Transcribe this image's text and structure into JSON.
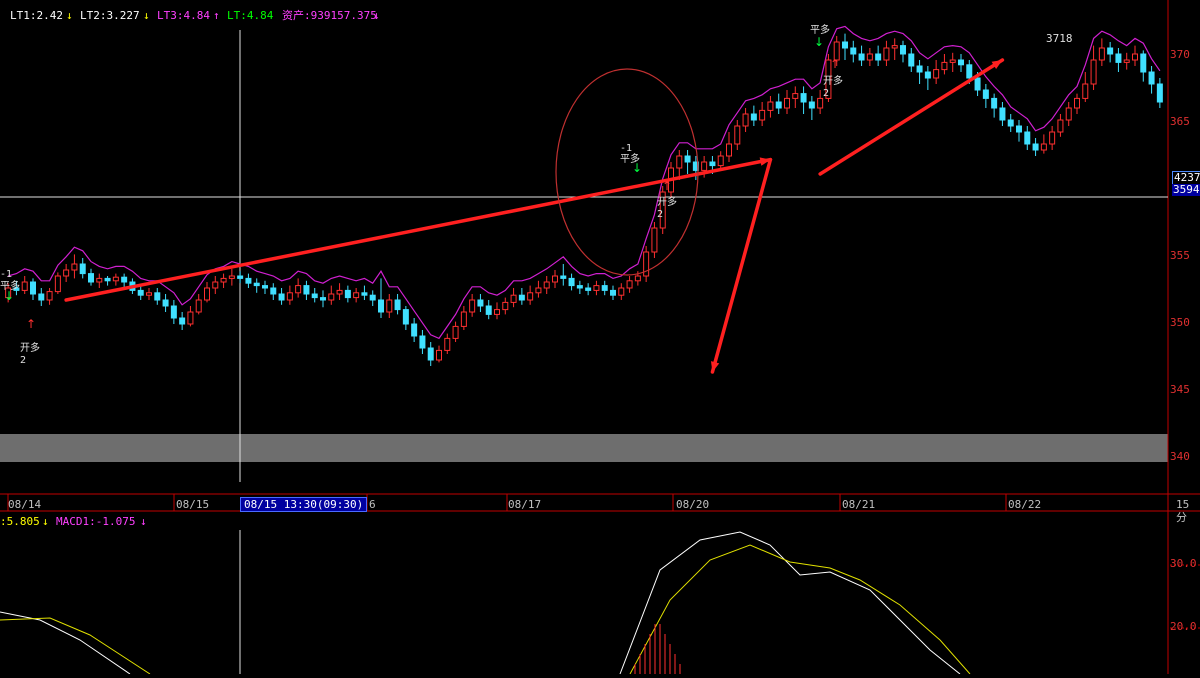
{
  "header": {
    "indicator_line": [
      {
        "text": "LT1:2.42",
        "color": "#ffffff",
        "arrow": "↓",
        "arrow_color": "#ffff00"
      },
      {
        "text": "LT2:3.227",
        "color": "#ffffff",
        "arrow": "↓",
        "arrow_color": "#ffff00"
      },
      {
        "text": "LT3:4.84",
        "color": "#ff40ff",
        "arrow": "↑",
        "arrow_color": "#ff40ff"
      },
      {
        "text": "LT:4.84",
        "color": "#00ff00",
        "arrow": "",
        "arrow_color": ""
      },
      {
        "text": "资产:939157.375",
        "color": "#ff40ff",
        "arrow": "↓",
        "arrow_color": "#ff40ff"
      }
    ],
    "macd_line": [
      {
        "text": ":5.805",
        "color": "#ffff00",
        "arrow": "↓",
        "arrow_color": "#ffff00"
      },
      {
        "text": "MACD1:-1.075",
        "color": "#ff40ff",
        "arrow": "↓",
        "arrow_color": "#ff40ff"
      }
    ]
  },
  "x_axis": {
    "dates": [
      "08/14",
      "08/15",
      "08/16",
      "08/17",
      "08/20",
      "08/21",
      "08/22"
    ],
    "crosshair_label": "08/15 13:30(09:30)",
    "period_label": "15分"
  },
  "annotations": {
    "open_long": "开多",
    "close_long": "平多",
    "qty": "2",
    "peak_label": "3718",
    "qty_small": "-1"
  },
  "price_tags": {
    "upper": "4237",
    "lower": "3594"
  },
  "chart_data": {
    "type": "candlestick",
    "y_axis_ticks": [
      "370",
      "365",
      "360",
      "355",
      "350",
      "345",
      "340"
    ],
    "macd_axis_ticks": [
      "30.0",
      "20.0"
    ],
    "ylim": [
      3390,
      3740
    ],
    "description_free": true,
    "candles": [
      [
        3502,
        3510,
        3498,
        3514
      ],
      [
        3510,
        3508,
        3504,
        3516
      ],
      [
        3508,
        3515,
        3505,
        3520
      ],
      [
        3515,
        3505,
        3500,
        3518
      ],
      [
        3505,
        3500,
        3495,
        3510
      ],
      [
        3500,
        3507,
        3496,
        3510
      ],
      [
        3507,
        3520,
        3505,
        3523
      ],
      [
        3520,
        3525,
        3515,
        3530
      ],
      [
        3525,
        3530,
        3518,
        3538
      ],
      [
        3530,
        3522,
        3518,
        3535
      ],
      [
        3522,
        3515,
        3512,
        3526
      ],
      [
        3515,
        3518,
        3510,
        3522
      ],
      [
        3518,
        3516,
        3512,
        3520
      ],
      [
        3516,
        3519,
        3512,
        3522
      ],
      [
        3519,
        3515,
        3510,
        3522
      ],
      [
        3515,
        3508,
        3505,
        3518
      ],
      [
        3508,
        3504,
        3500,
        3512
      ],
      [
        3504,
        3506,
        3500,
        3510
      ],
      [
        3506,
        3500,
        3496,
        3510
      ],
      [
        3500,
        3495,
        3490,
        3505
      ],
      [
        3495,
        3485,
        3480,
        3500
      ],
      [
        3485,
        3480,
        3475,
        3490
      ],
      [
        3480,
        3490,
        3478,
        3495
      ],
      [
        3490,
        3500,
        3488,
        3505
      ],
      [
        3500,
        3510,
        3498,
        3515
      ],
      [
        3510,
        3515,
        3505,
        3520
      ],
      [
        3515,
        3518,
        3510,
        3522
      ],
      [
        3518,
        3520,
        3512,
        3526
      ],
      [
        3520,
        3518,
        3514,
        3524
      ],
      [
        3518,
        3514,
        3510,
        3522
      ],
      [
        3514,
        3512,
        3506,
        3518
      ],
      [
        3512,
        3510,
        3505,
        3516
      ],
      [
        3510,
        3505,
        3500,
        3514
      ],
      [
        3505,
        3500,
        3496,
        3510
      ],
      [
        3500,
        3506,
        3496,
        3512
      ],
      [
        3506,
        3512,
        3502,
        3518
      ],
      [
        3512,
        3505,
        3500,
        3516
      ],
      [
        3505,
        3502,
        3498,
        3510
      ],
      [
        3502,
        3500,
        3494,
        3508
      ],
      [
        3500,
        3505,
        3496,
        3512
      ],
      [
        3505,
        3508,
        3500,
        3514
      ],
      [
        3508,
        3502,
        3498,
        3512
      ],
      [
        3502,
        3506,
        3498,
        3510
      ],
      [
        3506,
        3504,
        3500,
        3512
      ],
      [
        3504,
        3500,
        3495,
        3508
      ],
      [
        3500,
        3490,
        3485,
        3518
      ],
      [
        3490,
        3500,
        3485,
        3505
      ],
      [
        3500,
        3492,
        3488,
        3505
      ],
      [
        3492,
        3480,
        3475,
        3495
      ],
      [
        3480,
        3470,
        3465,
        3485
      ],
      [
        3470,
        3460,
        3455,
        3475
      ],
      [
        3460,
        3450,
        3445,
        3465
      ],
      [
        3450,
        3458,
        3448,
        3462
      ],
      [
        3458,
        3468,
        3455,
        3472
      ],
      [
        3468,
        3478,
        3465,
        3482
      ],
      [
        3478,
        3490,
        3475,
        3495
      ],
      [
        3490,
        3500,
        3486,
        3505
      ],
      [
        3500,
        3495,
        3490,
        3505
      ],
      [
        3495,
        3488,
        3484,
        3500
      ],
      [
        3488,
        3492,
        3484,
        3498
      ],
      [
        3492,
        3498,
        3488,
        3502
      ],
      [
        3498,
        3504,
        3494,
        3510
      ],
      [
        3504,
        3500,
        3496,
        3510
      ],
      [
        3500,
        3506,
        3496,
        3512
      ],
      [
        3506,
        3510,
        3502,
        3516
      ],
      [
        3510,
        3515,
        3505,
        3520
      ],
      [
        3515,
        3520,
        3510,
        3525
      ],
      [
        3520,
        3518,
        3512,
        3530
      ],
      [
        3518,
        3512,
        3508,
        3522
      ],
      [
        3512,
        3510,
        3505,
        3516
      ],
      [
        3510,
        3508,
        3504,
        3514
      ],
      [
        3508,
        3512,
        3504,
        3516
      ],
      [
        3512,
        3508,
        3504,
        3516
      ],
      [
        3508,
        3504,
        3500,
        3512
      ],
      [
        3504,
        3510,
        3500,
        3514
      ],
      [
        3510,
        3516,
        3506,
        3520
      ],
      [
        3516,
        3520,
        3512,
        3524
      ],
      [
        3520,
        3540,
        3515,
        3545
      ],
      [
        3540,
        3560,
        3535,
        3565
      ],
      [
        3560,
        3590,
        3555,
        3595
      ],
      [
        3590,
        3610,
        3585,
        3615
      ],
      [
        3610,
        3620,
        3600,
        3625
      ],
      [
        3620,
        3615,
        3605,
        3625
      ],
      [
        3615,
        3608,
        3600,
        3620
      ],
      [
        3608,
        3615,
        3602,
        3620
      ],
      [
        3615,
        3612,
        3605,
        3620
      ],
      [
        3612,
        3620,
        3608,
        3624
      ],
      [
        3620,
        3630,
        3615,
        3640
      ],
      [
        3630,
        3645,
        3625,
        3650
      ],
      [
        3645,
        3655,
        3640,
        3660
      ],
      [
        3655,
        3650,
        3645,
        3662
      ],
      [
        3650,
        3658,
        3645,
        3665
      ],
      [
        3658,
        3665,
        3652,
        3670
      ],
      [
        3665,
        3660,
        3655,
        3672
      ],
      [
        3660,
        3668,
        3655,
        3675
      ],
      [
        3668,
        3672,
        3660,
        3678
      ],
      [
        3672,
        3665,
        3655,
        3678
      ],
      [
        3665,
        3660,
        3650,
        3670
      ],
      [
        3660,
        3668,
        3655,
        3675
      ],
      [
        3668,
        3700,
        3665,
        3705
      ],
      [
        3700,
        3715,
        3695,
        3720
      ],
      [
        3715,
        3710,
        3700,
        3722
      ],
      [
        3710,
        3705,
        3698,
        3716
      ],
      [
        3705,
        3700,
        3695,
        3712
      ],
      [
        3700,
        3705,
        3695,
        3710
      ],
      [
        3705,
        3700,
        3695,
        3712
      ],
      [
        3700,
        3710,
        3695,
        3716
      ],
      [
        3710,
        3712,
        3700,
        3718
      ],
      [
        3712,
        3705,
        3698,
        3716
      ],
      [
        3705,
        3695,
        3690,
        3710
      ],
      [
        3695,
        3690,
        3680,
        3700
      ],
      [
        3690,
        3685,
        3675,
        3695
      ],
      [
        3685,
        3692,
        3680,
        3700
      ],
      [
        3692,
        3698,
        3688,
        3705
      ],
      [
        3698,
        3700,
        3690,
        3706
      ],
      [
        3700,
        3696,
        3690,
        3705
      ],
      [
        3696,
        3685,
        3680,
        3700
      ],
      [
        3685,
        3675,
        3670,
        3690
      ],
      [
        3675,
        3668,
        3660,
        3680
      ],
      [
        3668,
        3660,
        3652,
        3672
      ],
      [
        3660,
        3650,
        3645,
        3665
      ],
      [
        3650,
        3645,
        3640,
        3655
      ],
      [
        3645,
        3640,
        3632,
        3650
      ],
      [
        3640,
        3630,
        3625,
        3645
      ],
      [
        3630,
        3625,
        3620,
        3635
      ],
      [
        3625,
        3630,
        3622,
        3638
      ],
      [
        3630,
        3640,
        3625,
        3645
      ],
      [
        3640,
        3650,
        3636,
        3655
      ],
      [
        3650,
        3660,
        3645,
        3665
      ],
      [
        3660,
        3668,
        3655,
        3672
      ],
      [
        3668,
        3680,
        3665,
        3690
      ],
      [
        3680,
        3700,
        3675,
        3712
      ],
      [
        3700,
        3710,
        3695,
        3718
      ],
      [
        3710,
        3705,
        3698,
        3715
      ],
      [
        3705,
        3698,
        3690,
        3710
      ],
      [
        3698,
        3700,
        3692,
        3706
      ],
      [
        3700,
        3705,
        3695,
        3712
      ],
      [
        3705,
        3690,
        3682,
        3708
      ],
      [
        3690,
        3680,
        3672,
        3695
      ],
      [
        3680,
        3665,
        3660,
        3685
      ]
    ],
    "trade_lines": [
      {
        "from": [
          7,
          3500
        ],
        "to": [
          92,
          3617
        ],
        "color": "#ff2020"
      },
      {
        "from": [
          92,
          3617
        ],
        "to": [
          85,
          3440
        ],
        "color": "#ff2020"
      },
      {
        "from": [
          98,
          3605
        ],
        "to": [
          120,
          3700
        ],
        "color": "#ff2020"
      }
    ],
    "macd_histogram": [
      2,
      4,
      6,
      8,
      10,
      10,
      8,
      6,
      4,
      2
    ],
    "macd_note": "MACD lines shown without numeric values"
  }
}
